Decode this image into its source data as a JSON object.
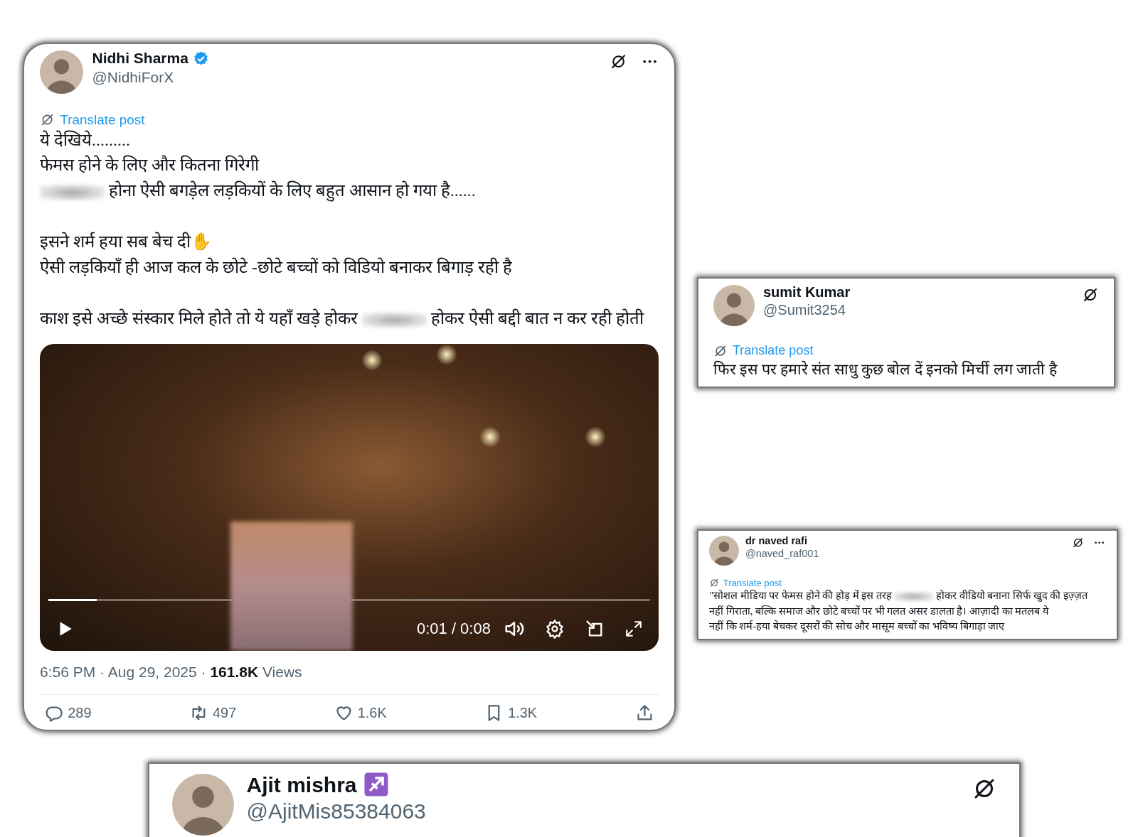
{
  "posts": [
    {
      "name": "Nidhi Sharma",
      "handle": "@NidhiForX",
      "badge": {
        "kind": "verified"
      },
      "more_menu": true,
      "translate": "Translate post",
      "paragraphs": [
        [
          [
            {
              "kind": "text",
              "text": "ये देखिये........."
            }
          ],
          [
            {
              "kind": "text",
              "text": "फेमस होने के लिए और कितना गिरेगी"
            }
          ],
          [
            {
              "kind": "blur"
            },
            {
              "kind": "text",
              "text": " होना ऐसी बगड़ेल लड़कियों के लिए बहुत आसान हो गया है......"
            }
          ]
        ],
        [
          [
            {
              "kind": "text",
              "text": "इसने शर्म हया सब बेच दी"
            },
            {
              "kind": "emoji",
              "text": "✋"
            }
          ],
          [
            {
              "kind": "text",
              "text": "ऐसी लड़कियाँ ही आज कल के छोटे -छोटे बच्चों को विडियो बनाकर बिगाड़ रही है"
            }
          ]
        ],
        [
          [
            {
              "kind": "text",
              "text": "काश इसे अच्छे संस्कार मिले होते तो ये यहाँ खड़े होकर "
            },
            {
              "kind": "blur"
            },
            {
              "kind": "text",
              "text": " होकर ऐसी बद्दी बात न कर रही होती"
            }
          ]
        ]
      ],
      "video": {
        "time": "0:01 / 0:08",
        "level": 0.08
      },
      "meta": "6:56 PM · Aug 29, 2025 · **161.8K** Views",
      "actions": [
        {
          "kind": "reply",
          "count": "289"
        },
        {
          "kind": "repost",
          "count": "497"
        },
        {
          "kind": "like",
          "count": "1.6K"
        },
        {
          "kind": "bookmark",
          "count": "1.3K"
        },
        {
          "kind": "share"
        }
      ]
    },
    {
      "name": "sumit Kumar",
      "handle": "@Sumit3254",
      "more_menu": false,
      "translate": "Translate post",
      "paragraphs": [
        [
          [
            {
              "kind": "text",
              "text": "फिर इस पर हमारे संत साधु कुछ बोल दें इनको मिर्ची लग जाती है"
            }
          ]
        ]
      ]
    },
    {
      "name": "dr naved rafi",
      "handle": "@naved_raf001",
      "more_menu": true,
      "translate": "Translate post",
      "paragraphs": [
        [
          [
            {
              "kind": "text",
              "text": "\"सोशल मीडिया पर फेमस होने की होड़ में इस तरह "
            },
            {
              "kind": "blur"
            },
            {
              "kind": "text",
              "text": " होकर वीडियो बनाना सिर्फ खुद की इज़्ज़त"
            }
          ],
          [
            {
              "kind": "text",
              "text": "नहीं गिराता, बल्कि समाज और छोटे बच्चों पर भी गलत असर डालता है। आज़ादी का मतलब ये"
            }
          ],
          [
            {
              "kind": "text",
              "text": "नहीं कि शर्म-हया बेचकर दूसरों की सोच और मासूम बच्चों का भविष्य बिगाड़ा जाए"
            }
          ]
        ]
      ]
    },
    {
      "name": "Ajit mishra",
      "handle": "@AjitMis85384063",
      "badge": {
        "kind": "zodiac"
      },
      "more_menu": false
    }
  ]
}
